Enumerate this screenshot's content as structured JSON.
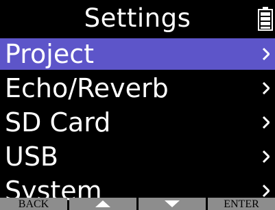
{
  "header": {
    "title": "Settings",
    "battery_icon": "battery-icon"
  },
  "menu": {
    "items": [
      {
        "label": "Project",
        "selected": true,
        "icon": "chevron-right-icon"
      },
      {
        "label": "Echo/Reverb",
        "selected": false,
        "icon": "chevron-right-icon"
      },
      {
        "label": "SD Card",
        "selected": false,
        "icon": "chevron-right-icon"
      },
      {
        "label": "USB",
        "selected": false,
        "icon": "chevron-right-icon"
      },
      {
        "label": "System",
        "selected": false,
        "icon": "chevron-right-icon"
      }
    ]
  },
  "footer": {
    "back_label": "BACK",
    "up_icon": "triangle-up-icon",
    "down_icon": "triangle-down-icon",
    "enter_label": "ENTER"
  },
  "colors": {
    "background": "#000000",
    "selection": "#5d55c9",
    "footer_button": "#8d8d8d",
    "text": "#ffffff"
  }
}
